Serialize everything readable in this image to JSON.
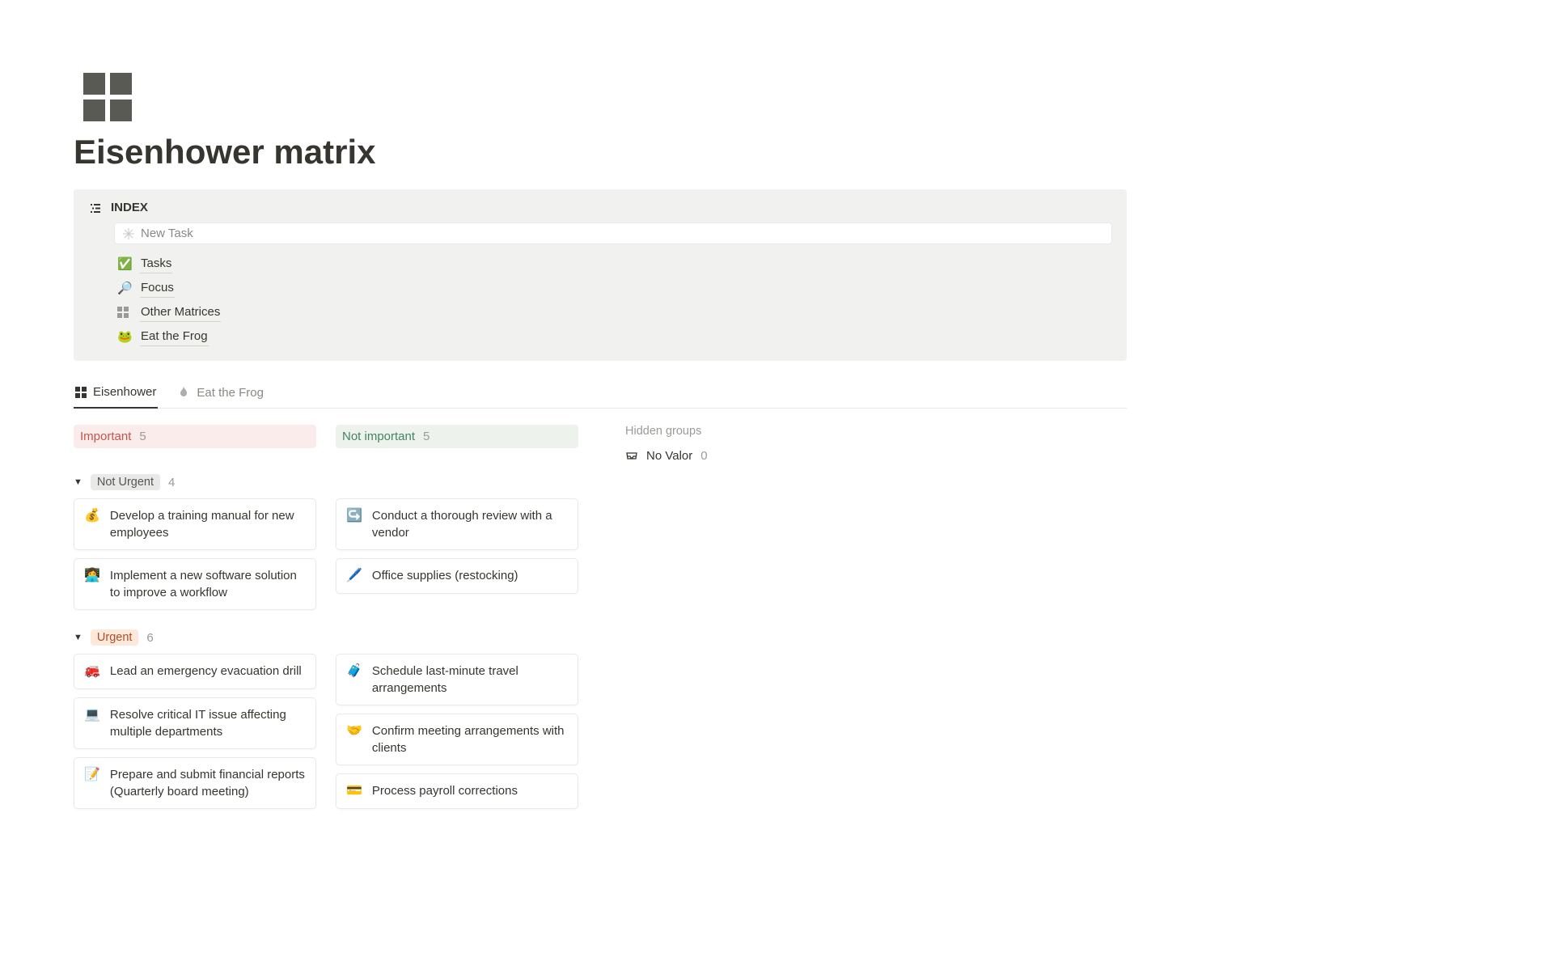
{
  "page": {
    "title": "Eisenhower matrix"
  },
  "toc": {
    "heading": "INDEX",
    "newTask": "New Task",
    "items": [
      {
        "icon": "✅",
        "label": "Tasks"
      },
      {
        "icon": "🔎",
        "label": "Focus"
      },
      {
        "iconKind": "grid",
        "label": "Other Matrices"
      },
      {
        "icon": "🐸",
        "label": "Eat the Frog"
      }
    ]
  },
  "tabs": [
    {
      "icon": "grid",
      "label": "Eisenhower",
      "active": true
    },
    {
      "icon": "flame",
      "label": "Eat the Frog",
      "active": false
    }
  ],
  "columns": [
    {
      "key": "important",
      "label": "Important",
      "count": 5
    },
    {
      "key": "not_important",
      "label": "Not important",
      "count": 5
    }
  ],
  "hidden": {
    "title": "Hidden groups",
    "noValor": {
      "label": "No Valor",
      "count": 0
    }
  },
  "groups": [
    {
      "key": "not_urgent",
      "label": "Not Urgent",
      "count": 4,
      "pill": "noturgent",
      "rows": {
        "important": [
          {
            "icon": "💰",
            "text": "Develop a training manual for new employees"
          },
          {
            "icon": "👩‍💻",
            "text": "Implement a new software solution to improve a workflow"
          }
        ],
        "not_important": [
          {
            "icon": "↪️",
            "text": "Conduct a thorough review with a vendor"
          },
          {
            "icon": "🖊️",
            "text": "Office supplies (restocking)"
          }
        ]
      }
    },
    {
      "key": "urgent",
      "label": "Urgent",
      "count": 6,
      "pill": "urgent",
      "rows": {
        "important": [
          {
            "icon": "🚒",
            "text": "Lead an emergency evacuation drill"
          },
          {
            "icon": "💻",
            "text": "Resolve critical IT issue affecting multiple departments"
          },
          {
            "icon": "📝",
            "text": "Prepare and submit financial reports (Quarterly board meeting)"
          }
        ],
        "not_important": [
          {
            "icon": "🧳",
            "text": "Schedule last-minute travel arrangements"
          },
          {
            "icon": "🤝",
            "text": "Confirm meeting arrangements with clients"
          },
          {
            "icon": "💳",
            "text": "Process payroll corrections"
          }
        ]
      }
    }
  ]
}
